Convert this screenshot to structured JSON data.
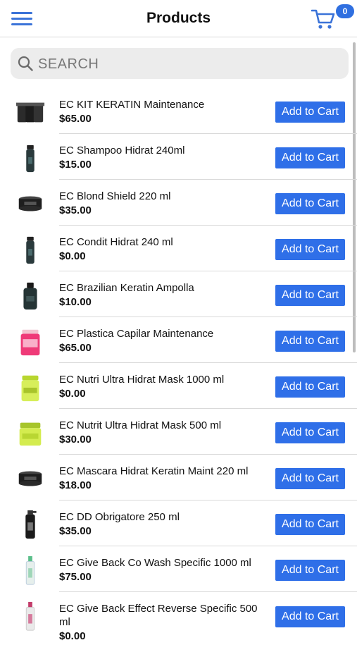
{
  "header": {
    "title": "Products",
    "cart_count": "0",
    "menu_icon": "hamburger-menu-icon",
    "cart_icon": "shopping-cart-icon"
  },
  "search": {
    "placeholder": "SEARCH",
    "value": ""
  },
  "colors": {
    "accent": "#2f6fe8",
    "icon": "#3b73d8"
  },
  "products": [
    {
      "name": "EC KIT KERATIN Maintenance",
      "price": "$65.00",
      "button": "Add to Cart",
      "thumb": "kit"
    },
    {
      "name": "EC Shampoo Hidrat 240ml",
      "price": "$15.00",
      "button": "Add to Cart",
      "thumb": "bottle"
    },
    {
      "name": "EC Blond Shield 220 ml",
      "price": "$35.00",
      "button": "Add to Cart",
      "thumb": "jar-dark"
    },
    {
      "name": "EC Condit Hidrat 240 ml",
      "price": "$0.00",
      "button": "Add to Cart",
      "thumb": "bottle"
    },
    {
      "name": "EC Brazilian Keratin Ampolla",
      "price": "$10.00",
      "button": "Add to Cart",
      "thumb": "ampolla"
    },
    {
      "name": "EC Plastica Capilar Maintenance",
      "price": "$65.00",
      "button": "Add to Cart",
      "thumb": "jar-pink"
    },
    {
      "name": "EC Nutri Ultra Hidrat Mask 1000 ml",
      "price": "$0.00",
      "button": "Add to Cart",
      "thumb": "tub-lime"
    },
    {
      "name": "EC Nutrit Ultra Hidrat Mask 500 ml",
      "price": "$30.00",
      "button": "Add to Cart",
      "thumb": "jar-lime"
    },
    {
      "name": "EC Mascara Hidrat Keratin Maint 220 ml",
      "price": "$18.00",
      "button": "Add to Cart",
      "thumb": "jar-dark"
    },
    {
      "name": "EC DD Obrigatore 250 ml",
      "price": "$35.00",
      "button": "Add to Cart",
      "thumb": "spray"
    },
    {
      "name": "EC Give Back Co Wash Specific 1000 ml",
      "price": "$75.00",
      "button": "Add to Cart",
      "thumb": "tube-clear"
    },
    {
      "name": "EC Give Back Effect Reverse Specific 500 ml",
      "price": "$0.00",
      "button": "Add to Cart",
      "thumb": "tube-pink"
    }
  ]
}
